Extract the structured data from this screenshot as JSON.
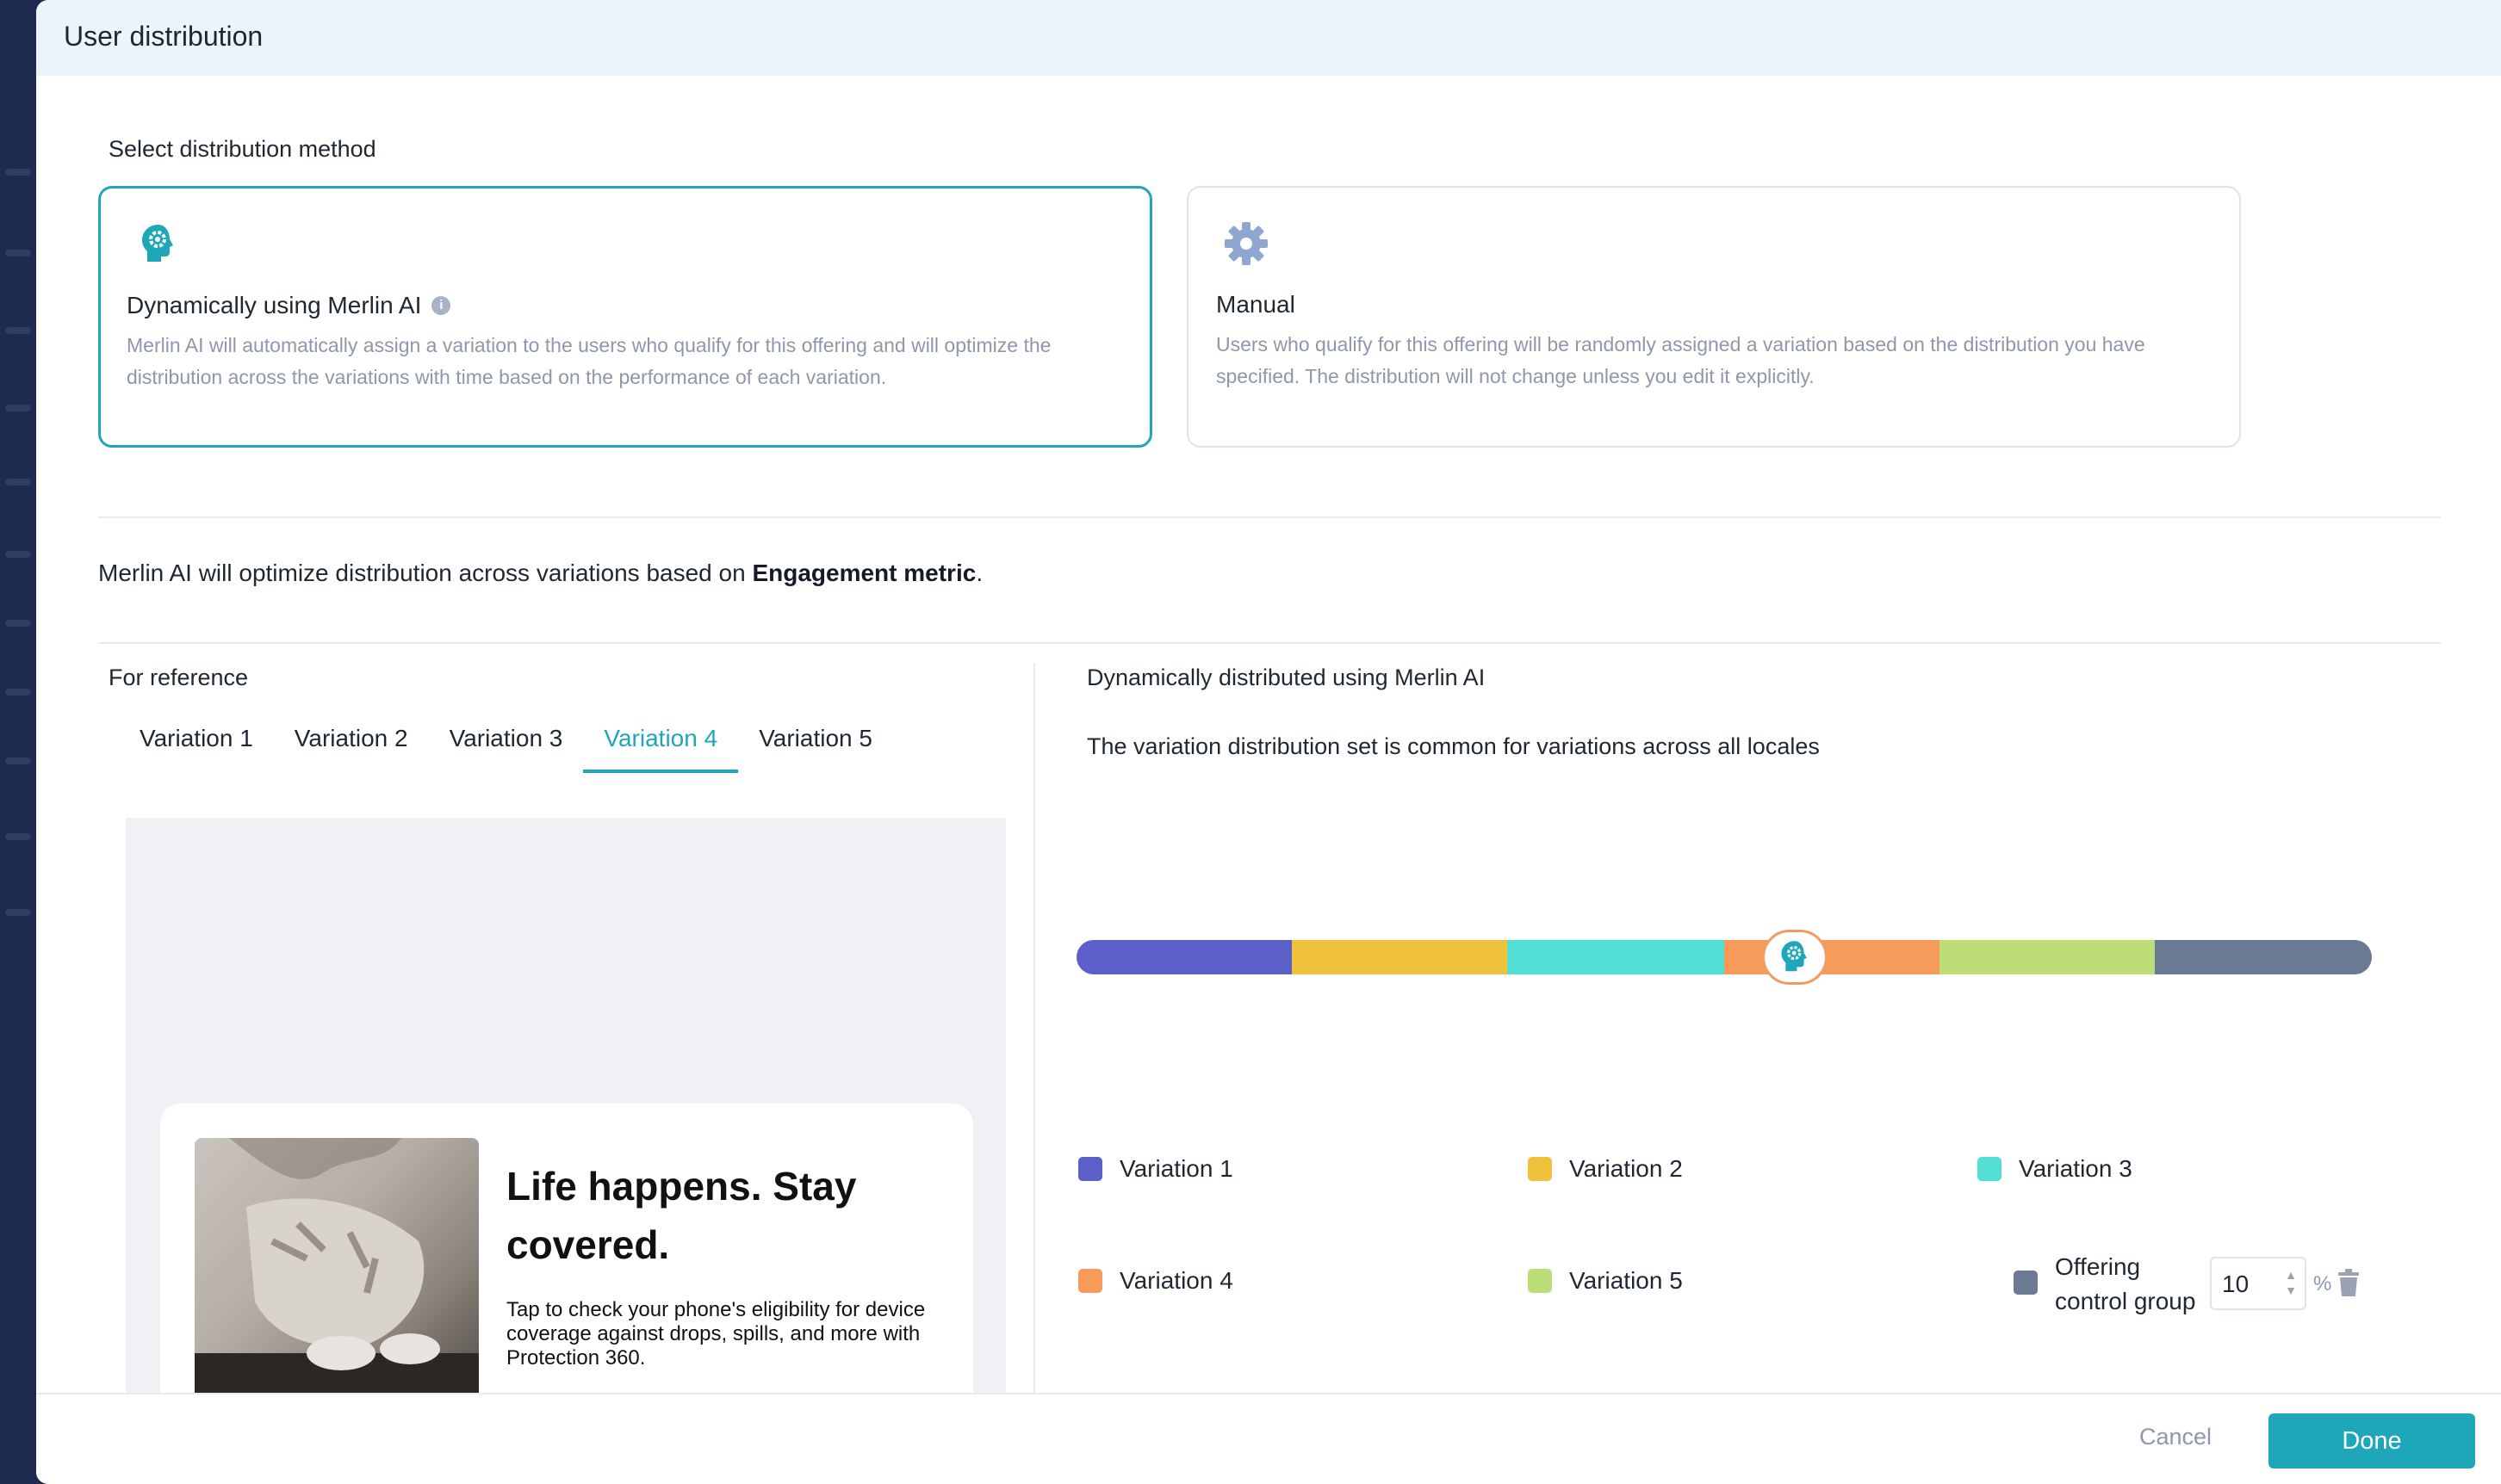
{
  "modal": {
    "title": "User distribution"
  },
  "method": {
    "section_label": "Select distribution method",
    "options": [
      {
        "title": "Dynamically using Merlin AI",
        "description": "Merlin AI will automatically assign a variation to the users who qualify for this offering and will optimize the distribution across the variations with time based on the performance of each variation.",
        "icon": "merlin-ai-head-icon",
        "selected": true
      },
      {
        "title": "Manual",
        "description": "Users who qualify for this offering will be randomly assigned a variation based on the distribution you have specified. The distribution will not change unless you edit it explicitly.",
        "icon": "gear-icon",
        "selected": false
      }
    ]
  },
  "metric_line": {
    "prefix": "Merlin AI will optimize distribution across variations based on ",
    "metric": "Engagement metric",
    "suffix": "."
  },
  "reference": {
    "label": "For reference",
    "tabs": [
      "Variation 1",
      "Variation 2",
      "Variation 3",
      "Variation 4",
      "Variation 5"
    ],
    "active_tab": "Variation 4",
    "preview": {
      "headline": "Life happens. Stay covered.",
      "body": "Tap to check your phone's eligibility for device coverage against drops, spills, and more with Protection 360."
    }
  },
  "distribution": {
    "label": "Dynamically distributed using Merlin AI",
    "note": "The variation distribution set is common for variations across all locales",
    "segments": [
      {
        "name": "Variation 1",
        "color": "#5b5fc7"
      },
      {
        "name": "Variation 2",
        "color": "#f0c23b"
      },
      {
        "name": "Variation 3",
        "color": "#54dfd6"
      },
      {
        "name": "Variation 4",
        "color": "#f79b5b"
      },
      {
        "name": "Variation 5",
        "color": "#bcdd78"
      },
      {
        "name": "Offering control group",
        "color": "#6a7a93"
      }
    ],
    "control_group": {
      "label": "Offering control group",
      "value": "10",
      "unit": "%"
    }
  },
  "footer": {
    "cancel": "Cancel",
    "done": "Done"
  }
}
